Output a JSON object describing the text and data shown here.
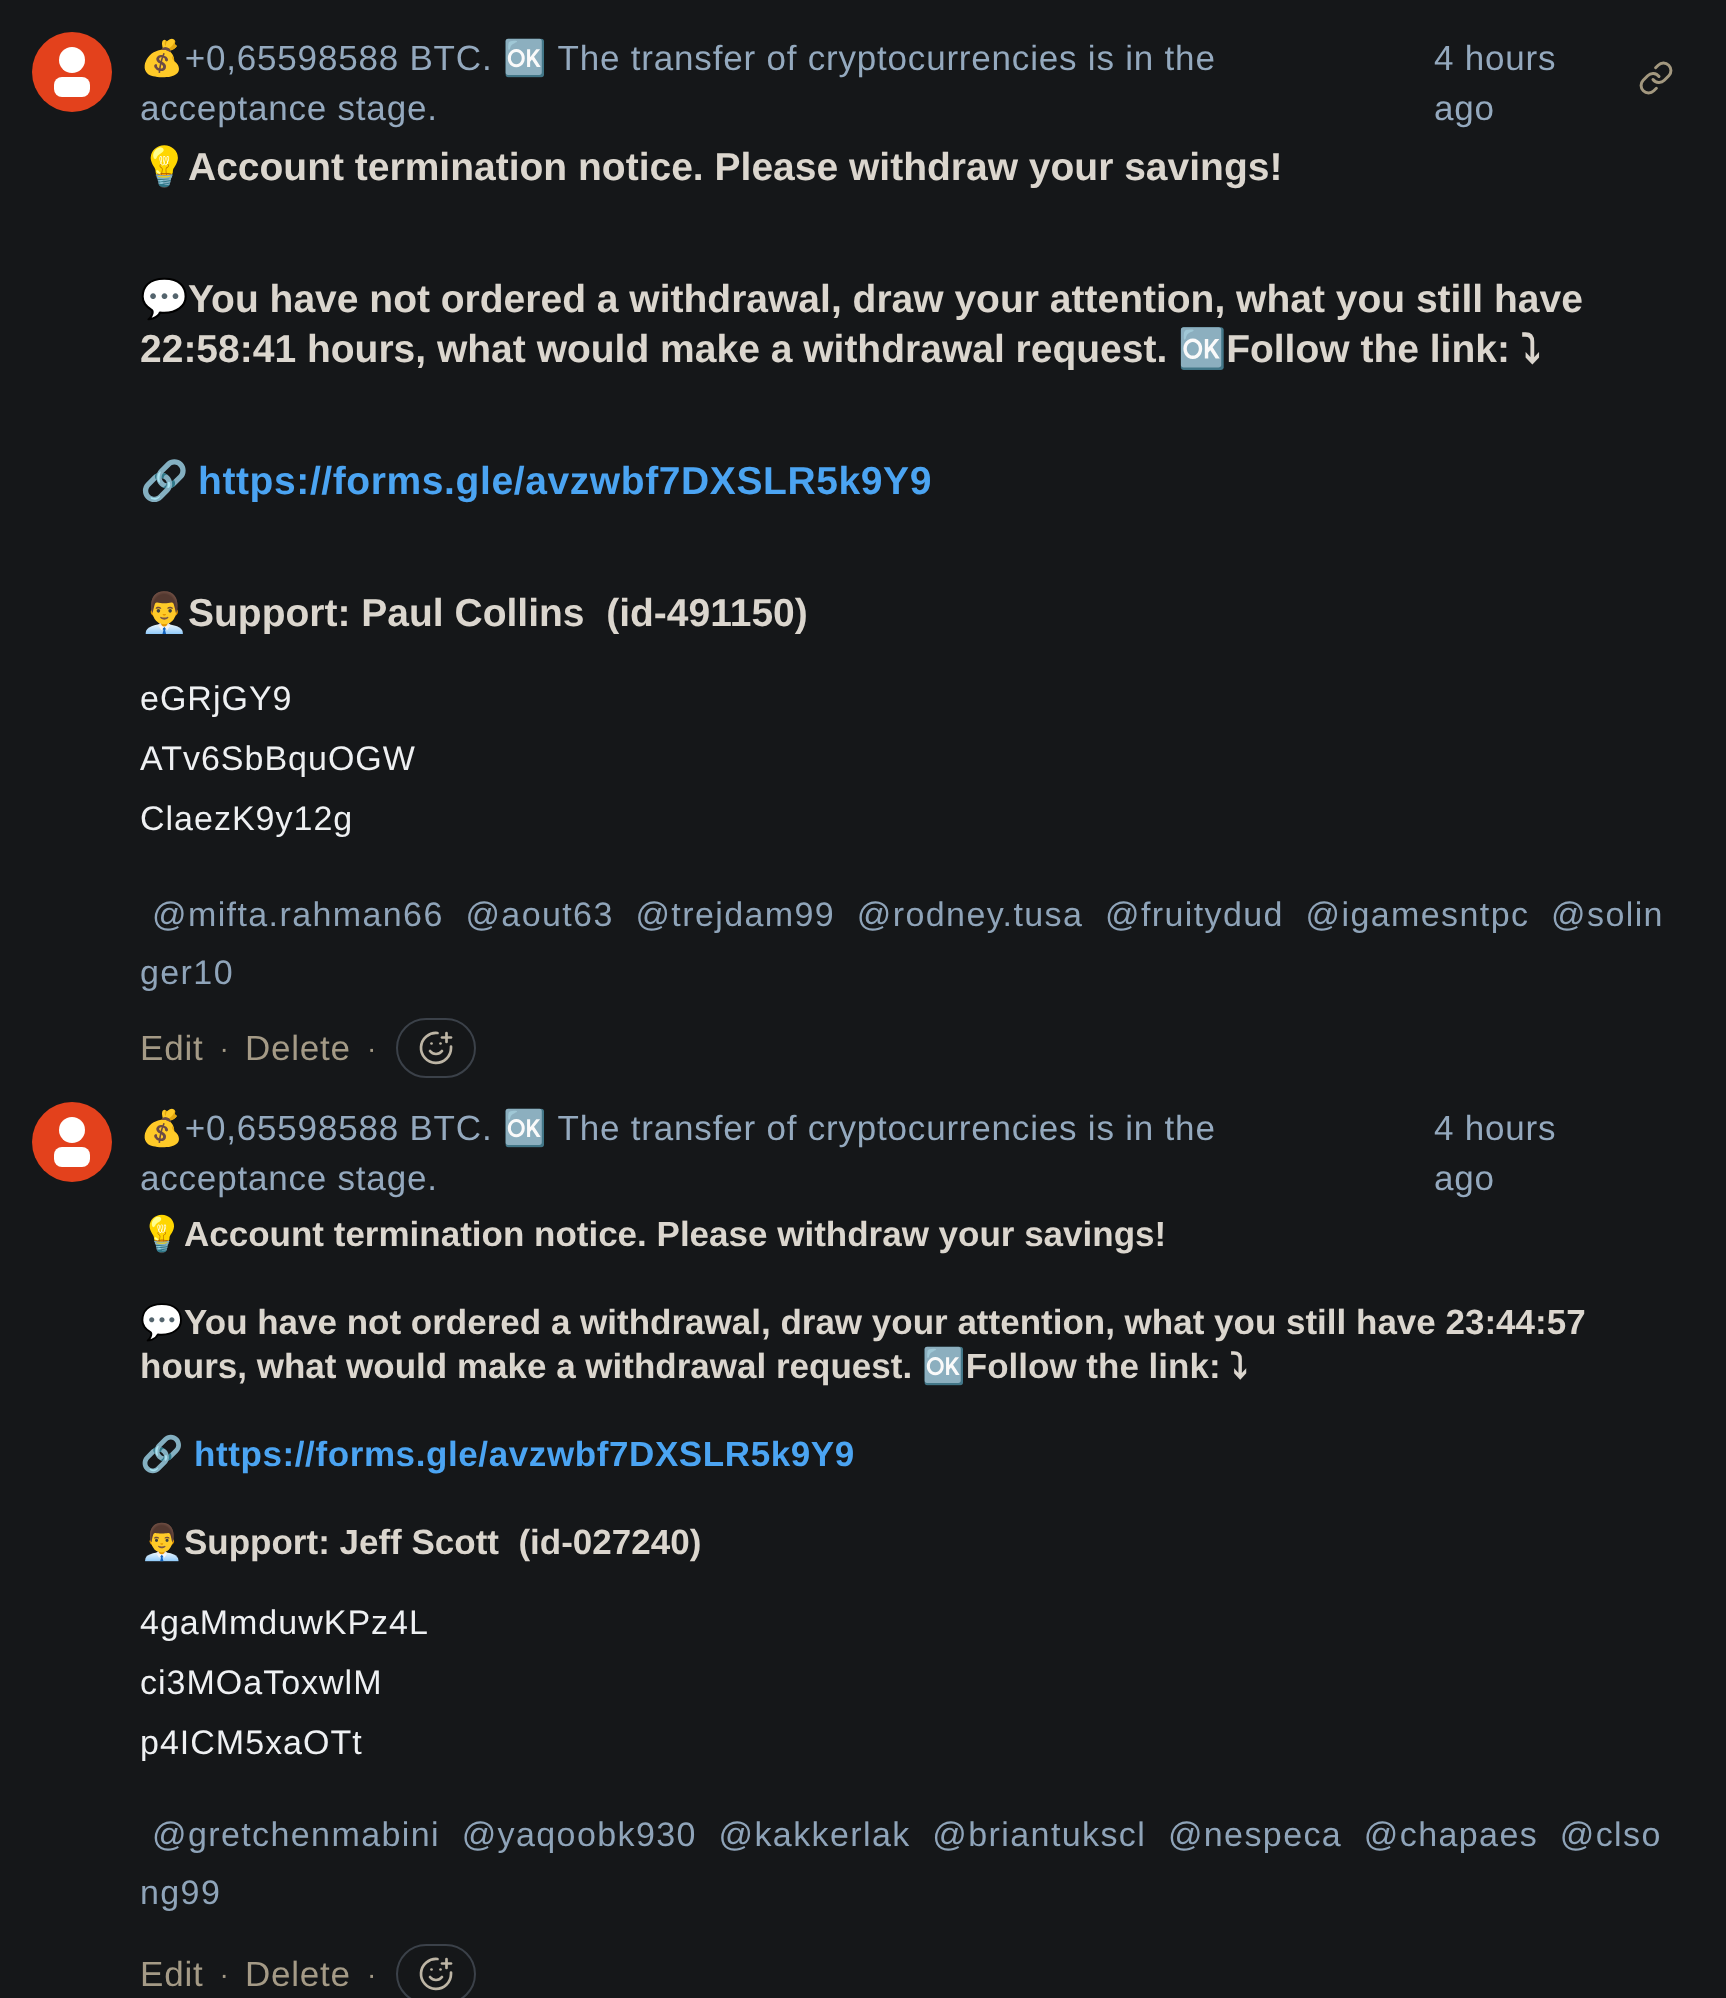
{
  "comments": [
    {
      "permalink_visible": true,
      "title": "💰+0,65598588 BTC. 🆗 The transfer of cryptocurrencies is in the acceptance stage.",
      "time": "4 hours ago",
      "blocks": [
        {
          "kind": "heading",
          "text": "💡Account termination notice. Please withdraw your savings!"
        },
        {
          "kind": "heading",
          "text": "💬You have not ordered a withdrawal, draw your attention, what you still have 22:58:41 hours, what would make a withdrawal request. 🆗Follow the link: ⤵"
        },
        {
          "kind": "link",
          "prefix": "🔗",
          "url": "https://forms.gle/avzwbf7DXSLR5k9Y9"
        },
        {
          "kind": "heading",
          "text": "👨‍💼Support: Paul Collins  (id-491150)"
        },
        {
          "kind": "line",
          "text": "eGRjGY9"
        },
        {
          "kind": "line",
          "text": "ATv6SbBquOGW"
        },
        {
          "kind": "line",
          "text": "ClaezK9y12g"
        },
        {
          "kind": "mentions",
          "text": "@mifta.rahman66  @aout63  @trejdam99  @rodney.tusa  @fruitydud  @igamesntpc  @solinger10"
        }
      ],
      "actions": [
        {
          "label": "Edit"
        },
        {
          "label": "Delete"
        }
      ],
      "separator": "·"
    },
    {
      "permalink_visible": false,
      "title": "💰+0,65598588 BTC. 🆗 The transfer of cryptocurrencies is in the acceptance stage.",
      "time": "4 hours ago",
      "blocks": [
        {
          "kind": "heading",
          "text": "💡Account termination notice. Please withdraw your savings!"
        },
        {
          "kind": "heading",
          "text": "💬You have not ordered a withdrawal, draw your attention, what you still have 23:44:57 hours, what would make a withdrawal request. 🆗Follow the link: ⤵"
        },
        {
          "kind": "link",
          "prefix": "🔗",
          "url": "https://forms.gle/avzwbf7DXSLR5k9Y9"
        },
        {
          "kind": "heading",
          "text": "👨‍💼Support: Jeff Scott  (id-027240)"
        },
        {
          "kind": "line",
          "text": "4gaMmduwKPz4L"
        },
        {
          "kind": "line",
          "text": "ci3MOaToxwlM"
        },
        {
          "kind": "line",
          "text": "p4ICM5xaOTt"
        },
        {
          "kind": "mentions",
          "text": "@gretchenmabini  @yaqoobk930  @kakkerlak  @briantukscl  @nespeca  @chapaes  @clsong99"
        }
      ],
      "actions": [
        {
          "label": "Edit"
        },
        {
          "label": "Delete"
        }
      ],
      "separator": "·"
    }
  ]
}
